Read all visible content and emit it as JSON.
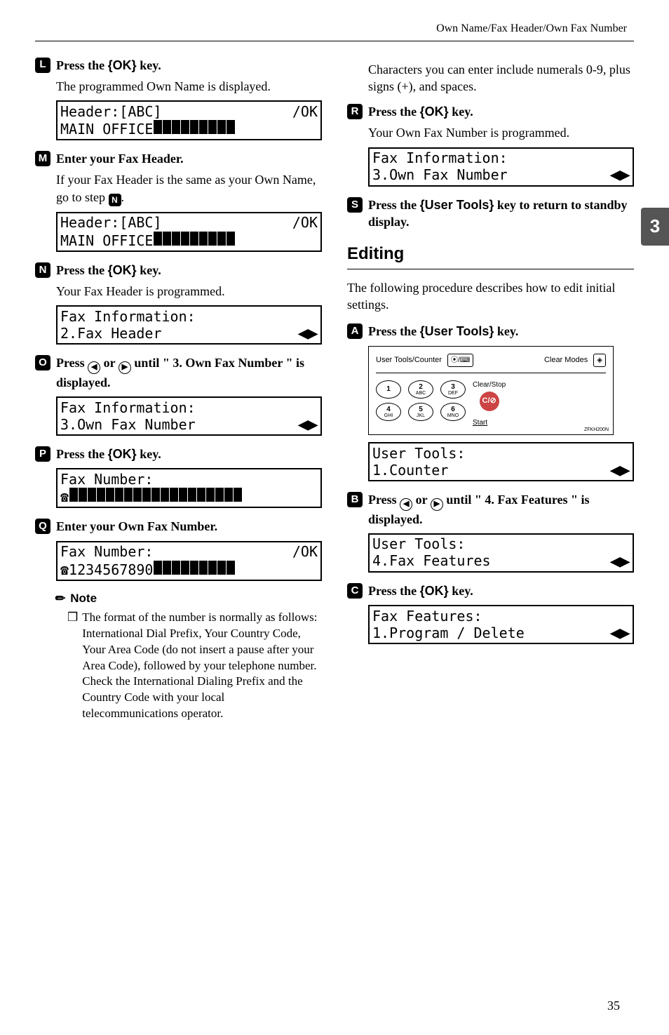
{
  "page": {
    "running_head": "Own Name/Fax Header/Own Fax Number",
    "number": "35",
    "side_tab": "3"
  },
  "labels": {
    "ok_key": "OK",
    "user_tools_key": "User Tools",
    "note_heading": "Note"
  },
  "left": {
    "s12": {
      "pre": "Press the ",
      "post": " key.",
      "body": "The programmed Own Name is displayed.",
      "lcd1a": "Header:[ABC]",
      "lcd1b_right": "/OK",
      "lcd2": "MAIN OFFICE"
    },
    "s13": {
      "title": "Enter your Fax Header.",
      "body_a": "If your Fax Header is the same as your Own Name, go to step ",
      "body_ref": "N",
      "body_b": ".",
      "lcd1a": "Header:[ABC]",
      "lcd1b_right": "/OK",
      "lcd2": "MAIN OFFICE"
    },
    "s14": {
      "pre": "Press the ",
      "post": " key.",
      "body": "Your Fax Header is programmed.",
      "lcd1": "Fax Information:",
      "lcd2": "2.Fax Header"
    },
    "s15": {
      "pre": "Press ",
      "mid": " or ",
      "post": " until \" 3. Own Fax Number \" is displayed.",
      "lcd1": "Fax Information:",
      "lcd2": "3.Own Fax Number"
    },
    "s16": {
      "pre": "Press the ",
      "post": " key.",
      "lcd1": "Fax Number:"
    },
    "s17": {
      "title": "Enter your Own Fax Number.",
      "lcd1": "Fax Number:",
      "lcd1_right": "/OK",
      "lcd2": "1234567890"
    },
    "note": "The format of the number is normally as follows: International Dial Prefix, Your Country Code, Your Area Code (do not insert a pause after your Area Code), followed by your telephone number. Check the International Dialing Prefix and the Country Code with your local telecommunications operator."
  },
  "right": {
    "intro": "Characters you can enter include numerals 0-9, plus signs (+), and spaces.",
    "s18": {
      "pre": "Press the ",
      "post": " key.",
      "body": "Your Own Fax Number is programmed.",
      "lcd1": "Fax Information:",
      "lcd2": "3.Own Fax Number"
    },
    "s19": {
      "pre": "Press the ",
      "post": " key to return to standby display."
    },
    "editing_head": "Editing",
    "editing_intro": "The following procedure describes how to edit initial settings.",
    "e1": {
      "pre": "Press the ",
      "post": " key."
    },
    "panel": {
      "user_tools_label": "User Tools/Counter",
      "clear_modes": "Clear Modes",
      "clear_stop": "Clear/Stop",
      "cs_sym": "C/",
      "start": "Start",
      "code": "ZFKH200N",
      "k1": "1",
      "k2": "2",
      "k2s": "ABC",
      "k3": "3",
      "k3s": "DEF",
      "k4": "4",
      "k4s": "GHI",
      "k5": "5",
      "k5s": "JKL",
      "k6": "6",
      "k6s": "MNO"
    },
    "e1_lcd1": "User Tools:",
    "e1_lcd2": "1.Counter",
    "e2": {
      "pre": "Press ",
      "mid": " or ",
      "post": " until \" 4. Fax Features \" is displayed.",
      "lcd1": "User Tools:",
      "lcd2": "4.Fax Features"
    },
    "e3": {
      "pre": "Press the ",
      "post": " key.",
      "lcd1": "Fax Features:",
      "lcd2": "1.Program / Delete"
    }
  }
}
